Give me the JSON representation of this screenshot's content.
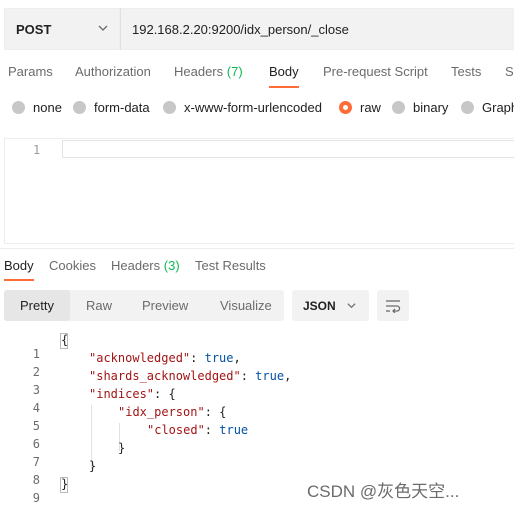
{
  "request": {
    "method": "POST",
    "url": "192.168.2.20:9200/idx_person/_close"
  },
  "request_tabs": {
    "params": "Params",
    "authorization": "Authorization",
    "headers": "Headers",
    "headers_count": "(7)",
    "body": "Body",
    "pre_request_script": "Pre-request Script",
    "tests": "Tests",
    "settings_partial": "S"
  },
  "body_types": {
    "none": "none",
    "form_data": "form-data",
    "urlencoded": "x-www-form-urlencoded",
    "raw": "raw",
    "binary": "binary",
    "graphql_partial": "Graph",
    "selected": "raw"
  },
  "request_editor": {
    "line_number": "1"
  },
  "response_tabs": {
    "body": "Body",
    "cookies": "Cookies",
    "headers": "Headers",
    "headers_count": "(3)",
    "test_results": "Test Results"
  },
  "view_modes": {
    "pretty": "Pretty",
    "raw": "Raw",
    "preview": "Preview",
    "visualize": "Visualize",
    "format": "JSON"
  },
  "response_code": {
    "line_numbers": [
      "1",
      "2",
      "3",
      "4",
      "5",
      "6",
      "7",
      "8",
      "9"
    ],
    "l1": "{",
    "l2_key": "\"acknowledged\"",
    "l2_val": "true",
    "l3_key": "\"shards_acknowledged\"",
    "l3_val": "true",
    "l4_key": "\"indices\"",
    "l4_open": "{",
    "l5_key": "\"idx_person\"",
    "l5_open": "{",
    "l6_key": "\"closed\"",
    "l6_val": "true",
    "l7": "}",
    "l8": "}",
    "l9": "}",
    "colon": ": ",
    "comma": ","
  },
  "watermark": "CSDN @灰色天空..."
}
